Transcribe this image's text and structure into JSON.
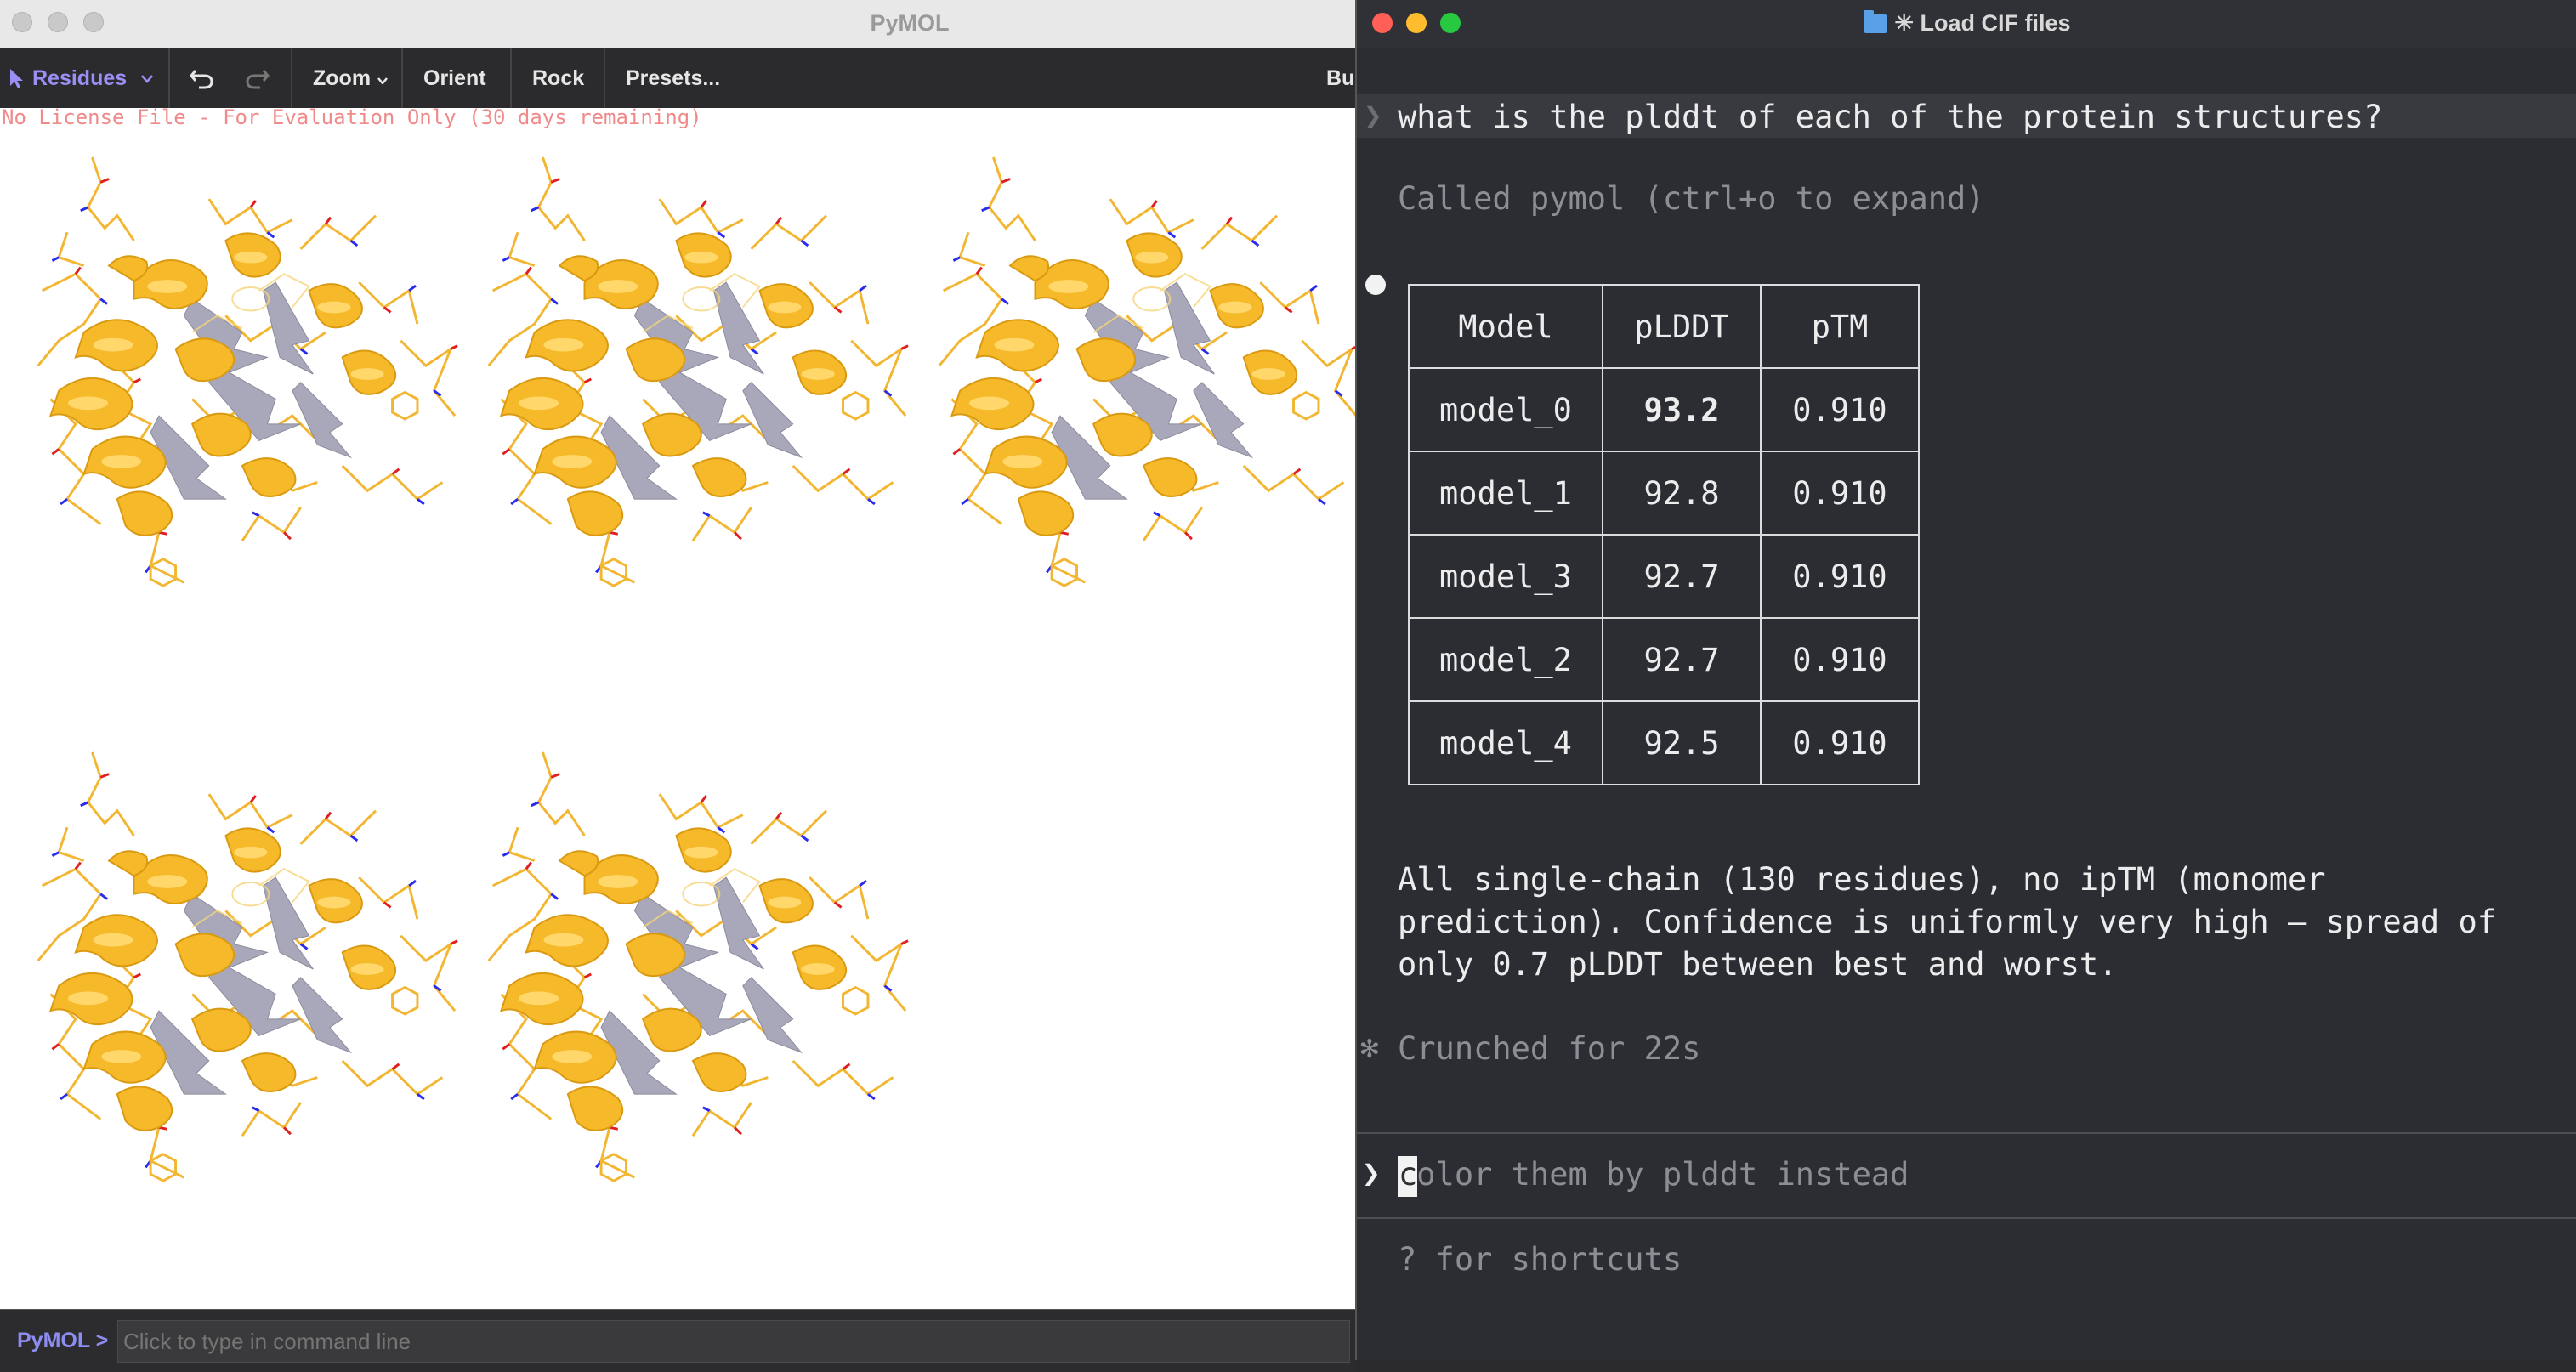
{
  "pymol": {
    "window_title": "PyMOL",
    "toolbar": {
      "selection_mode": "Residues",
      "zoom": "Zoom",
      "orient": "Orient",
      "rock": "Rock",
      "presets": "Presets...",
      "builder_partial": "Bu"
    },
    "license_text": "No License File - For Evaluation Only (30 days remaining)",
    "command_prompt": "PyMOL >",
    "command_placeholder": "Click to type in command line",
    "colors": {
      "cartoon": "#f6b92a",
      "sheet": "#a8a8ba",
      "oxygen": "#e02020",
      "nitrogen": "#2a2af0"
    }
  },
  "terminal": {
    "window_title": "✳ Load CIF files",
    "user_message": "what is the plddt of each of the protein structures?",
    "tool_call": "Called pymol (ctrl+o to expand)",
    "table": {
      "headers": [
        "Model",
        "pLDDT",
        "pTM"
      ],
      "rows": [
        [
          "model_0",
          "93.2",
          "0.910"
        ],
        [
          "model_1",
          "92.8",
          "0.910"
        ],
        [
          "model_3",
          "92.7",
          "0.910"
        ],
        [
          "model_2",
          "92.7",
          "0.910"
        ],
        [
          "model_4",
          "92.5",
          "0.910"
        ]
      ]
    },
    "summary_lines": [
      "All single-chain (130 residues), no ipTM (monomer",
      "prediction). Confidence is uniformly very high — spread of",
      "only 0.7 pLDDT between best and worst."
    ],
    "crunch_symbol": "✻",
    "crunched": "Crunched for 22s",
    "input_prompt": "❯",
    "input_cursor_char": "c",
    "input_text": "color them by plddt instead",
    "shortcuts_hint": "? for shortcuts",
    "colors": {
      "background": "#2b2d33",
      "text": "#ececec",
      "muted": "#8c8e94"
    }
  }
}
